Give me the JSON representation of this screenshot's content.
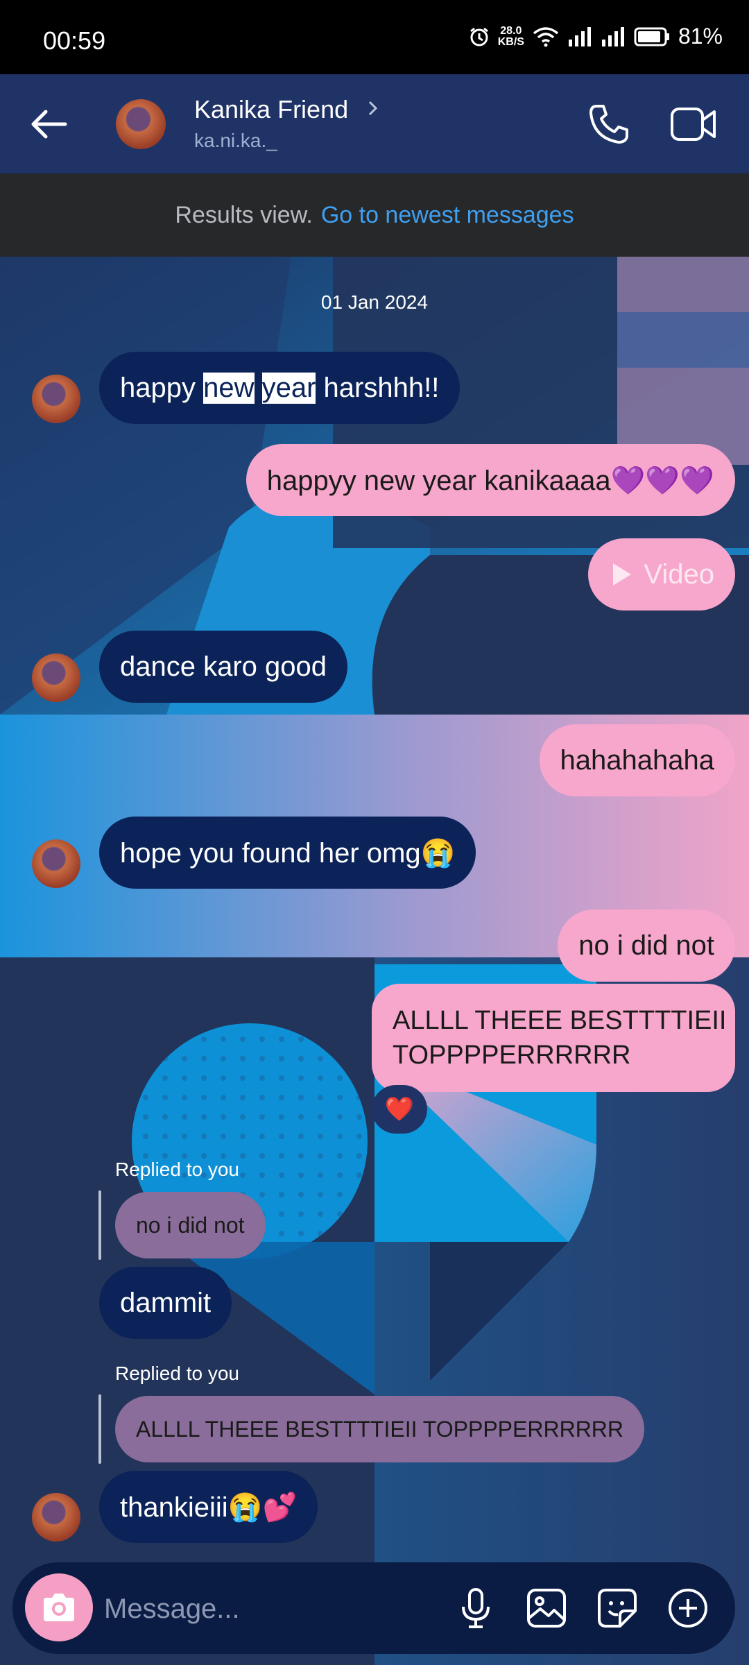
{
  "status_bar": {
    "time": "00:59",
    "net_speed_value": "28.0",
    "net_speed_unit": "KB/S",
    "battery": "81%"
  },
  "header": {
    "contact_name": "Kanika Friend",
    "contact_handle": "ka.ni.ka._"
  },
  "results_bar": {
    "label": "Results view.",
    "link": "Go to newest messages"
  },
  "date_separator": "01 Jan 2024",
  "messages": [
    {
      "from": "them",
      "parts": [
        "happy ",
        "new",
        " ",
        "year",
        " harshhh!!"
      ]
    },
    {
      "from": "me",
      "text": "happyy new year kanikaaaa💜💜💜"
    },
    {
      "from": "me",
      "type": "video",
      "label": "Video"
    },
    {
      "from": "them",
      "text": "dance karo good"
    },
    {
      "from": "me",
      "text": "hahahahaha"
    },
    {
      "from": "them",
      "text": "hope you found her omg😭"
    },
    {
      "from": "me",
      "text": "no i did not"
    },
    {
      "from": "me",
      "lines": [
        "ALLLL THEEE BESTTTTIEII",
        "TOPPPPERRRRRR"
      ],
      "reaction": "❤️"
    },
    {
      "from": "them",
      "reply_label": "Replied to you",
      "quoted": "no i did not",
      "text": "dammit"
    },
    {
      "from": "them",
      "reply_label": "Replied to you",
      "quoted": "ALLLL THEEE BESTTTTIEII TOPPPPERRRRRR",
      "text": "thankieiii😭💕"
    }
  ],
  "composer": {
    "placeholder": "Message..."
  },
  "colors": {
    "header_bg": "#1f3366",
    "incoming_bubble": "#0b2358",
    "outgoing_bubble": "#f7a6cc",
    "link": "#3fa0f2",
    "quoted_bubble": "#8a6d9a"
  },
  "icons": [
    "back-arrow-icon",
    "chevron-right-icon",
    "phone-icon",
    "video-call-icon",
    "play-icon",
    "camera-icon",
    "microphone-icon",
    "gallery-icon",
    "sticker-icon",
    "plus-circle-icon",
    "alarm-icon",
    "wifi-icon",
    "signal-icon",
    "battery-icon"
  ]
}
